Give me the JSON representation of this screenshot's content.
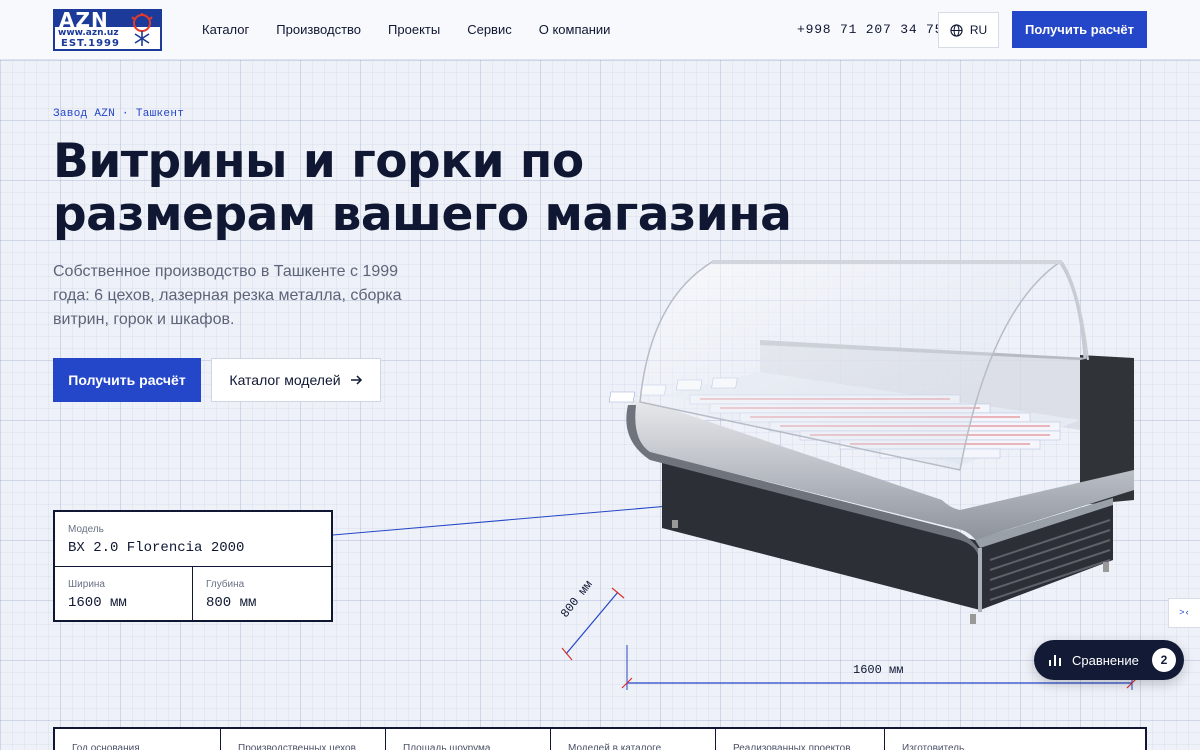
{
  "logo": {
    "name": "AZN",
    "url": "www.azn.uz",
    "est": "EST.1999"
  },
  "nav": [
    "Каталог",
    "Производство",
    "Проекты",
    "Сервис",
    "О компании"
  ],
  "header": {
    "phone": "+998 71 207 34 75",
    "lang": "RU",
    "cta": "Получить расчёт"
  },
  "hero": {
    "breadcrumb": "Завод AZN · Ташкент",
    "title_line1": "Витрины и горки по",
    "title_line2": "размерам вашего магазина",
    "lead": "Собственное производство в Ташкенте с 1999 года: 6 цехов, лазерная резка металла, сборка витрин, горок и шкафов.",
    "btn_primary": "Получить расчёт",
    "btn_catalog": "Каталог моделей"
  },
  "spec": {
    "model_label": "Модель",
    "model_value": "BX 2.0 Florencia 2000",
    "width_label": "Ширина",
    "width_value": "1600 мм",
    "depth_label": "Глубина",
    "depth_value": "800 мм"
  },
  "dims": {
    "depth": "800 мм",
    "width": "1600 мм"
  },
  "compare": {
    "label": "Сравнение",
    "count": "2"
  },
  "side_tab": ">‹",
  "stats": [
    "Год основания",
    "Производственных цехов",
    "Площадь шоурума",
    "Моделей в каталоге",
    "Реализованных проектов",
    "Изготовитель"
  ],
  "colors": {
    "accent": "#2446c8",
    "dark": "#0f1733"
  }
}
